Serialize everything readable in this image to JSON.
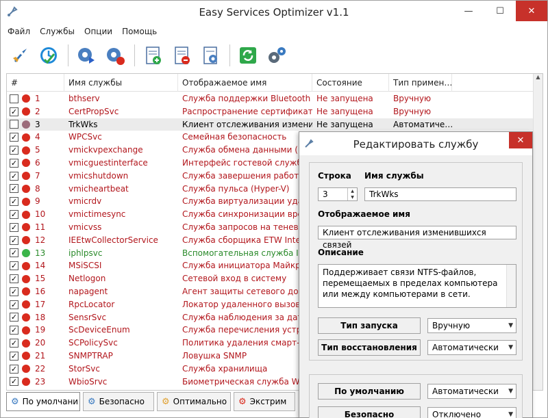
{
  "window": {
    "title": "Easy Services Optimizer v1.1",
    "controls": {
      "minimize": "—",
      "maximize": "☐",
      "close": "✕"
    }
  },
  "menu": [
    "Файл",
    "Службы",
    "Опции",
    "Помощь"
  ],
  "toolbar_icons": [
    "rocket-icon",
    "clock-icon",
    "gear-run-icon",
    "gear-stop-icon",
    "doc-add-icon",
    "doc-remove-icon",
    "doc-settings-icon",
    "refresh-icon",
    "settings-gears-icon"
  ],
  "list": {
    "headers": [
      "#",
      "Имя службы",
      "Отображаемое имя",
      "Состояние",
      "Тип примен…"
    ],
    "rows": [
      {
        "checked": false,
        "color": "red",
        "num": "1",
        "name": "bthserv",
        "display": "Служба поддержки Bluetooth",
        "state": "Не запущена",
        "type": "Вручную"
      },
      {
        "checked": true,
        "color": "red",
        "num": "2",
        "name": "CertPropSvc",
        "display": "Распространение сертификата",
        "state": "Не запущена",
        "type": "Вручную"
      },
      {
        "checked": false,
        "color": "gray",
        "num": "3",
        "name": "TrkWks",
        "display": "Клиент отслеживания измени…",
        "state": "Не запущена",
        "type": "Автоматиче…",
        "selected": true
      },
      {
        "checked": true,
        "color": "red",
        "num": "4",
        "name": "WPCSvc",
        "display": "Семейная безопасность",
        "state": "",
        "type": ""
      },
      {
        "checked": true,
        "color": "red",
        "num": "5",
        "name": "vmickvpexchange",
        "display": "Служба обмена данными (Hy…",
        "state": "",
        "type": ""
      },
      {
        "checked": true,
        "color": "red",
        "num": "6",
        "name": "vmicguestinterface",
        "display": "Интерфейс гостевой службы",
        "state": "",
        "type": ""
      },
      {
        "checked": true,
        "color": "red",
        "num": "7",
        "name": "vmicshutdown",
        "display": "Служба завершения работы …",
        "state": "",
        "type": ""
      },
      {
        "checked": true,
        "color": "red",
        "num": "8",
        "name": "vmicheartbeat",
        "display": "Служба пульса (Hyper-V)",
        "state": "",
        "type": ""
      },
      {
        "checked": true,
        "color": "red",
        "num": "9",
        "name": "vmicrdv",
        "display": "Служба виртуализации удал…",
        "state": "",
        "type": ""
      },
      {
        "checked": true,
        "color": "red",
        "num": "10",
        "name": "vmictimesync",
        "display": "Служба синхронизации време…",
        "state": "",
        "type": ""
      },
      {
        "checked": true,
        "color": "red",
        "num": "11",
        "name": "vmicvss",
        "display": "Служба запросов на теневое …",
        "state": "",
        "type": ""
      },
      {
        "checked": true,
        "color": "red",
        "num": "12",
        "name": "IEEtwCollectorService",
        "display": "Служба сборщика ETW Intern…",
        "state": "",
        "type": ""
      },
      {
        "checked": true,
        "color": "green",
        "num": "13",
        "name": "iphlpsvc",
        "display": "Вспомогательная служба IP",
        "state": "",
        "type": ""
      },
      {
        "checked": true,
        "color": "red",
        "num": "14",
        "name": "MSiSCSI",
        "display": "Служба инициатора Майкрос…",
        "state": "",
        "type": ""
      },
      {
        "checked": true,
        "color": "red",
        "num": "15",
        "name": "Netlogon",
        "display": "Сетевой вход в систему",
        "state": "",
        "type": ""
      },
      {
        "checked": true,
        "color": "red",
        "num": "16",
        "name": "napagent",
        "display": "Агент защиты сетевого дост…",
        "state": "",
        "type": ""
      },
      {
        "checked": true,
        "color": "red",
        "num": "17",
        "name": "RpcLocator",
        "display": "Локатор удаленного вызова …",
        "state": "",
        "type": ""
      },
      {
        "checked": true,
        "color": "red",
        "num": "18",
        "name": "SensrSvc",
        "display": "Служба наблюдения за датч…",
        "state": "",
        "type": ""
      },
      {
        "checked": true,
        "color": "red",
        "num": "19",
        "name": "ScDeviceEnum",
        "display": "Служба перечисления устрой…",
        "state": "",
        "type": ""
      },
      {
        "checked": true,
        "color": "red",
        "num": "20",
        "name": "SCPolicySvc",
        "display": "Политика удаления смарт-кар…",
        "state": "",
        "type": ""
      },
      {
        "checked": true,
        "color": "red",
        "num": "21",
        "name": "SNMPTRAP",
        "display": "Ловушка SNMP",
        "state": "",
        "type": ""
      },
      {
        "checked": true,
        "color": "red",
        "num": "22",
        "name": "StorSvc",
        "display": "Служба хранилища",
        "state": "",
        "type": ""
      },
      {
        "checked": true,
        "color": "red",
        "num": "23",
        "name": "WbioSrvc",
        "display": "Биометрическая служба Wind…",
        "state": "",
        "type": ""
      }
    ]
  },
  "bottom_tabs": [
    {
      "label": "По умолчани",
      "icon": "gear-icon"
    },
    {
      "label": "Безопасно",
      "icon": "gear-icon"
    },
    {
      "label": "Оптимально",
      "icon": "gear-icon"
    },
    {
      "label": "Экстрим",
      "icon": "gear-icon"
    }
  ],
  "dialog": {
    "title": "Редактировать службу",
    "row_label": "Строка",
    "row_value": "3",
    "service_name_label": "Имя службы",
    "service_name_value": "TrkWks",
    "display_name_label": "Отображаемое имя",
    "display_name_value": "Клиент отслеживания изменившихся связей",
    "description_label": "Описание",
    "description_value": "Поддерживает связи NTFS-файлов, перемещаемых в пределах компьютера или между компьютерами в сети.",
    "startup_type_label": "Тип запуска",
    "startup_type_value": "Вручную",
    "recovery_type_label": "Тип восстановления",
    "recovery_type_value": "Автоматически",
    "default_label": "По умолчанию",
    "default_value": "Автоматически",
    "safe_label": "Безопасно",
    "safe_value": "Отключено"
  },
  "colors": {
    "text_red": "#b2161c",
    "text_green": "#2a8a2a",
    "dot_red": "#d92b1e",
    "dot_gray": "#9b6b7a",
    "dot_green": "#3bb54a",
    "close_red": "#c7312a"
  }
}
